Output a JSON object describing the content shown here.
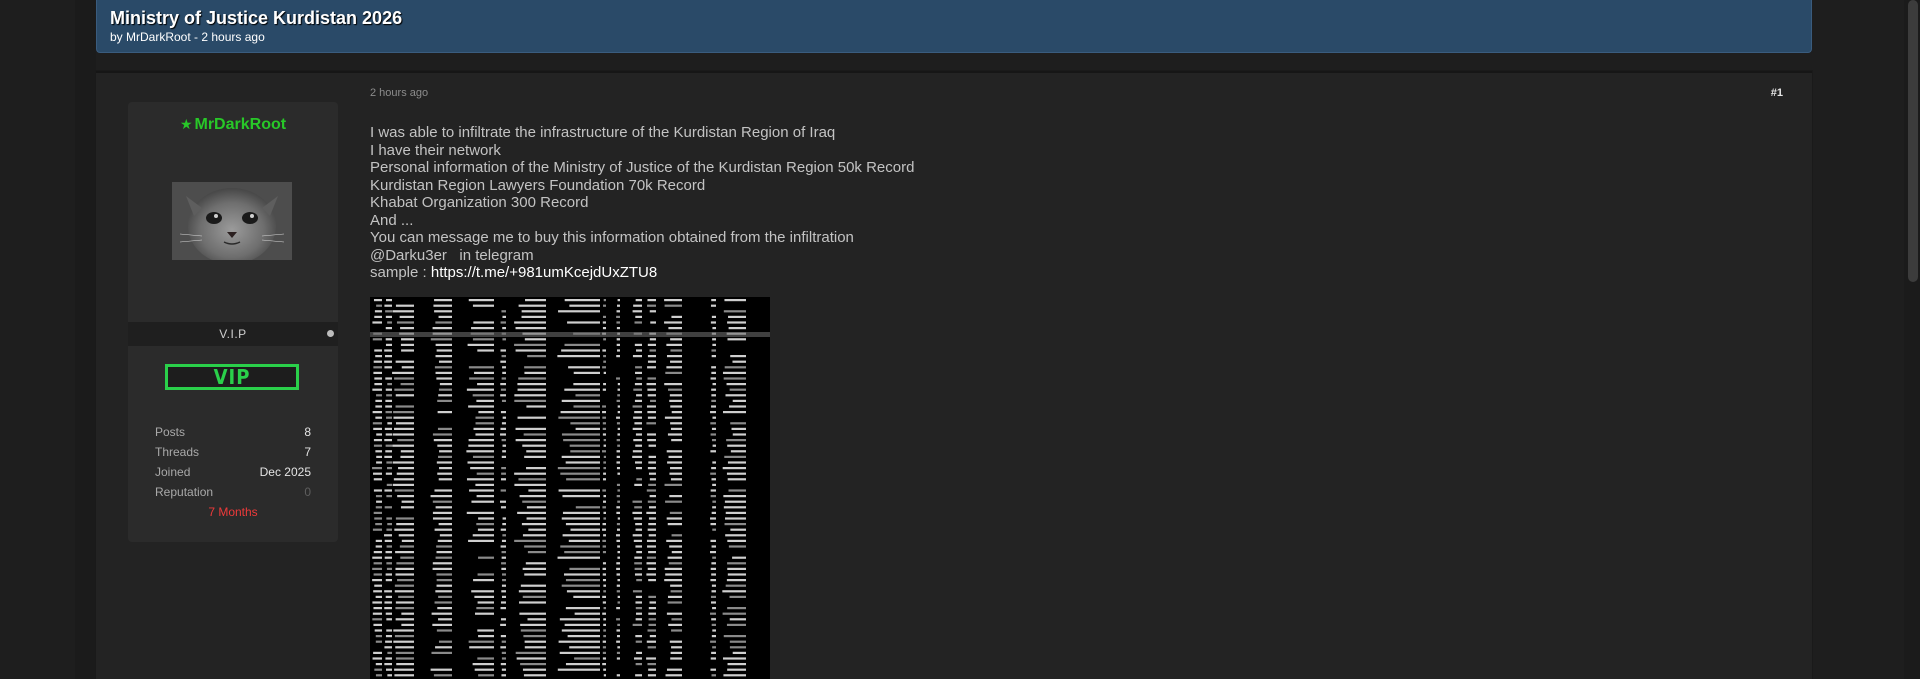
{
  "thread": {
    "title": "Ministry of Justice Kurdistan 2026",
    "by_prefix": "by ",
    "author": "MrDarkRoot",
    "time_suffix": " - 2 hours ago"
  },
  "post": {
    "date": "2 hours ago",
    "number": "#1",
    "lines": [
      "I was able to infiltrate the infrastructure of the Kurdistan Region of Iraq",
      "I have their network",
      "Personal information of the Ministry of Justice of the Kurdistan Region 50k Record",
      "Kurdistan Region Lawyers Foundation 70k Record",
      "Khabat Organization 300 Record",
      "And ...",
      "You can message me to buy this information obtained from the infiltration",
      "@Darku3er   in telegram"
    ],
    "sample_label": "sample : ",
    "sample_link": "https://t.me/+981umKcejdUxZTU8"
  },
  "author_panel": {
    "username": "MrDarkRoot",
    "rank_title": "V.I.P",
    "badge": "VIP",
    "stats": [
      {
        "label": "Posts",
        "value": "8"
      },
      {
        "label": "Threads",
        "value": "7"
      },
      {
        "label": "Joined",
        "value": "Dec 2025"
      },
      {
        "label": "Reputation",
        "value": "0"
      }
    ],
    "tenure": "7 Months"
  },
  "colors": {
    "header_bg": "#2a4a68",
    "username_green": "#28c828",
    "vip_green": "#2ad04a",
    "tenure_red": "#ef3a3a",
    "page_bg": "#1e1e1e"
  },
  "icons": {
    "username_prefix": "star-icon",
    "online_status": "status-dot-icon"
  }
}
